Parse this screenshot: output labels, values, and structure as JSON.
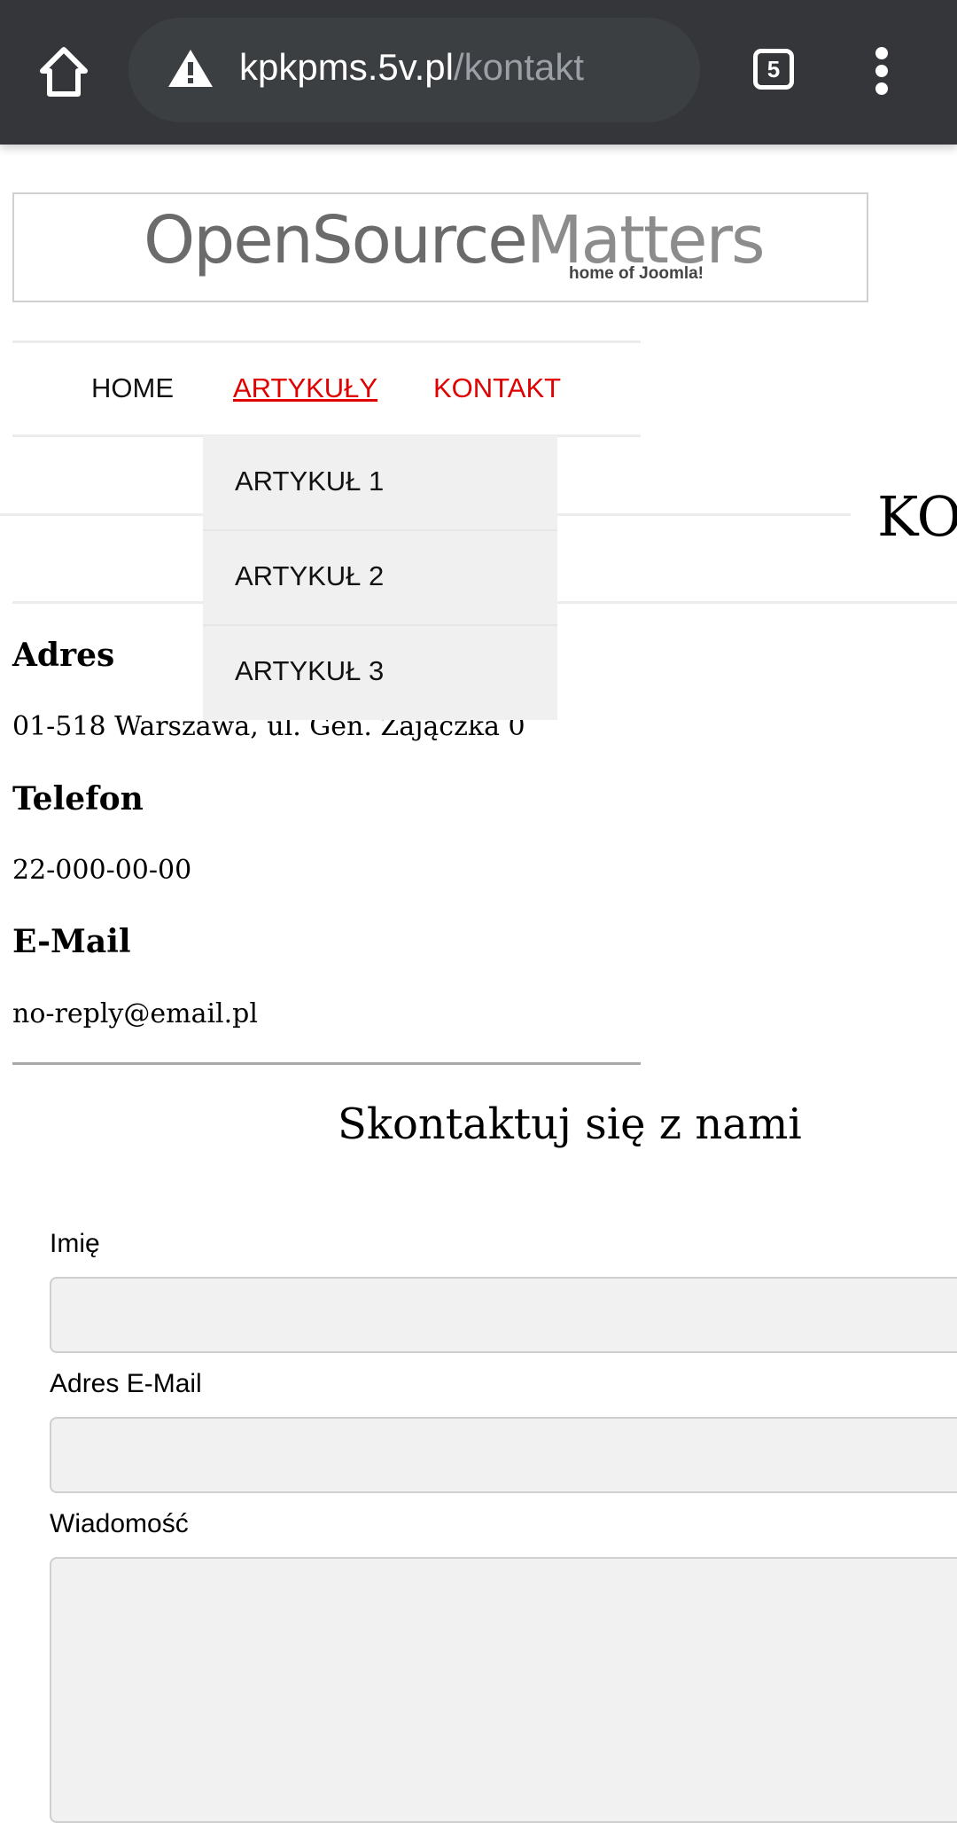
{
  "browser": {
    "url_host": "kpkpms.5v.pl",
    "url_path": "/kontakt",
    "tab_count": "5"
  },
  "logo": {
    "main": "OpenSource",
    "main2": "Matters",
    "sub": "home of Joomla!"
  },
  "nav": {
    "items": [
      "HOME",
      "ARTYKUŁY",
      "KONTAKT"
    ],
    "dropdown": [
      "ARTYKUŁ 1",
      "ARTYKUŁ 2",
      "ARTYKUŁ 3"
    ]
  },
  "page": {
    "title_partial": "KO"
  },
  "contact": {
    "address_label": "Adres",
    "address": "01-518 Warszawa, ul. Gen. Zajączka 0",
    "phone_label": "Telefon",
    "phone": "22-000-00-00",
    "email_label": "E-Mail",
    "email": "no-reply@email.pl"
  },
  "form": {
    "title": "Skontaktuj się z nami",
    "name_label": "Imię",
    "email_label": "Adres E-Mail",
    "message_label": "Wiadomość"
  },
  "colors": {
    "accent": "#e00000",
    "toolbar": "#35363a"
  }
}
